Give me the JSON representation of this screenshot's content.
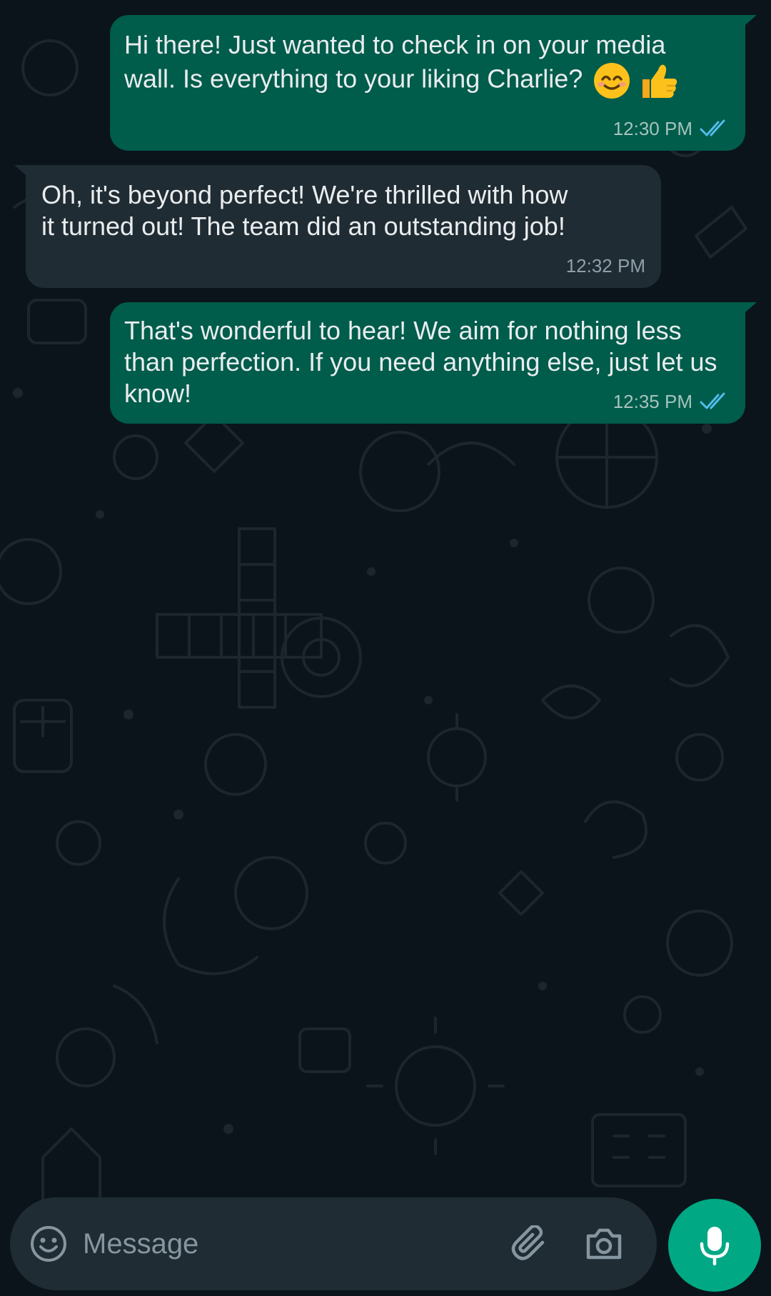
{
  "messages": [
    {
      "direction": "outgoing",
      "text_line1": "Hi there! Just wanted to check in on your media",
      "text_line2": "wall. Is everything to your liking Charlie?",
      "emojis": [
        "smiling-face-icon",
        "thumbs-up-icon"
      ],
      "time": "12:30 PM",
      "status": "read"
    },
    {
      "direction": "incoming",
      "text": "Oh, it's beyond perfect! We're thrilled with how\nit turned out! The team did an outstanding job!",
      "time": "12:32 PM"
    },
    {
      "direction": "outgoing",
      "text": "That's wonderful to hear! We aim for nothing less\nthan perfection. If you need anything else, just let us\nknow!",
      "time": "12:35 PM",
      "status": "read"
    }
  ],
  "composer": {
    "placeholder": "Message",
    "icons": [
      "emoji-icon",
      "attachment-icon",
      "camera-icon",
      "microphone-icon"
    ]
  },
  "colors": {
    "background": "#0b141a",
    "outgoing_bubble": "#005c4b",
    "incoming_bubble": "#202c33",
    "read_ticks": "#53bdeb",
    "accent": "#00a884"
  }
}
